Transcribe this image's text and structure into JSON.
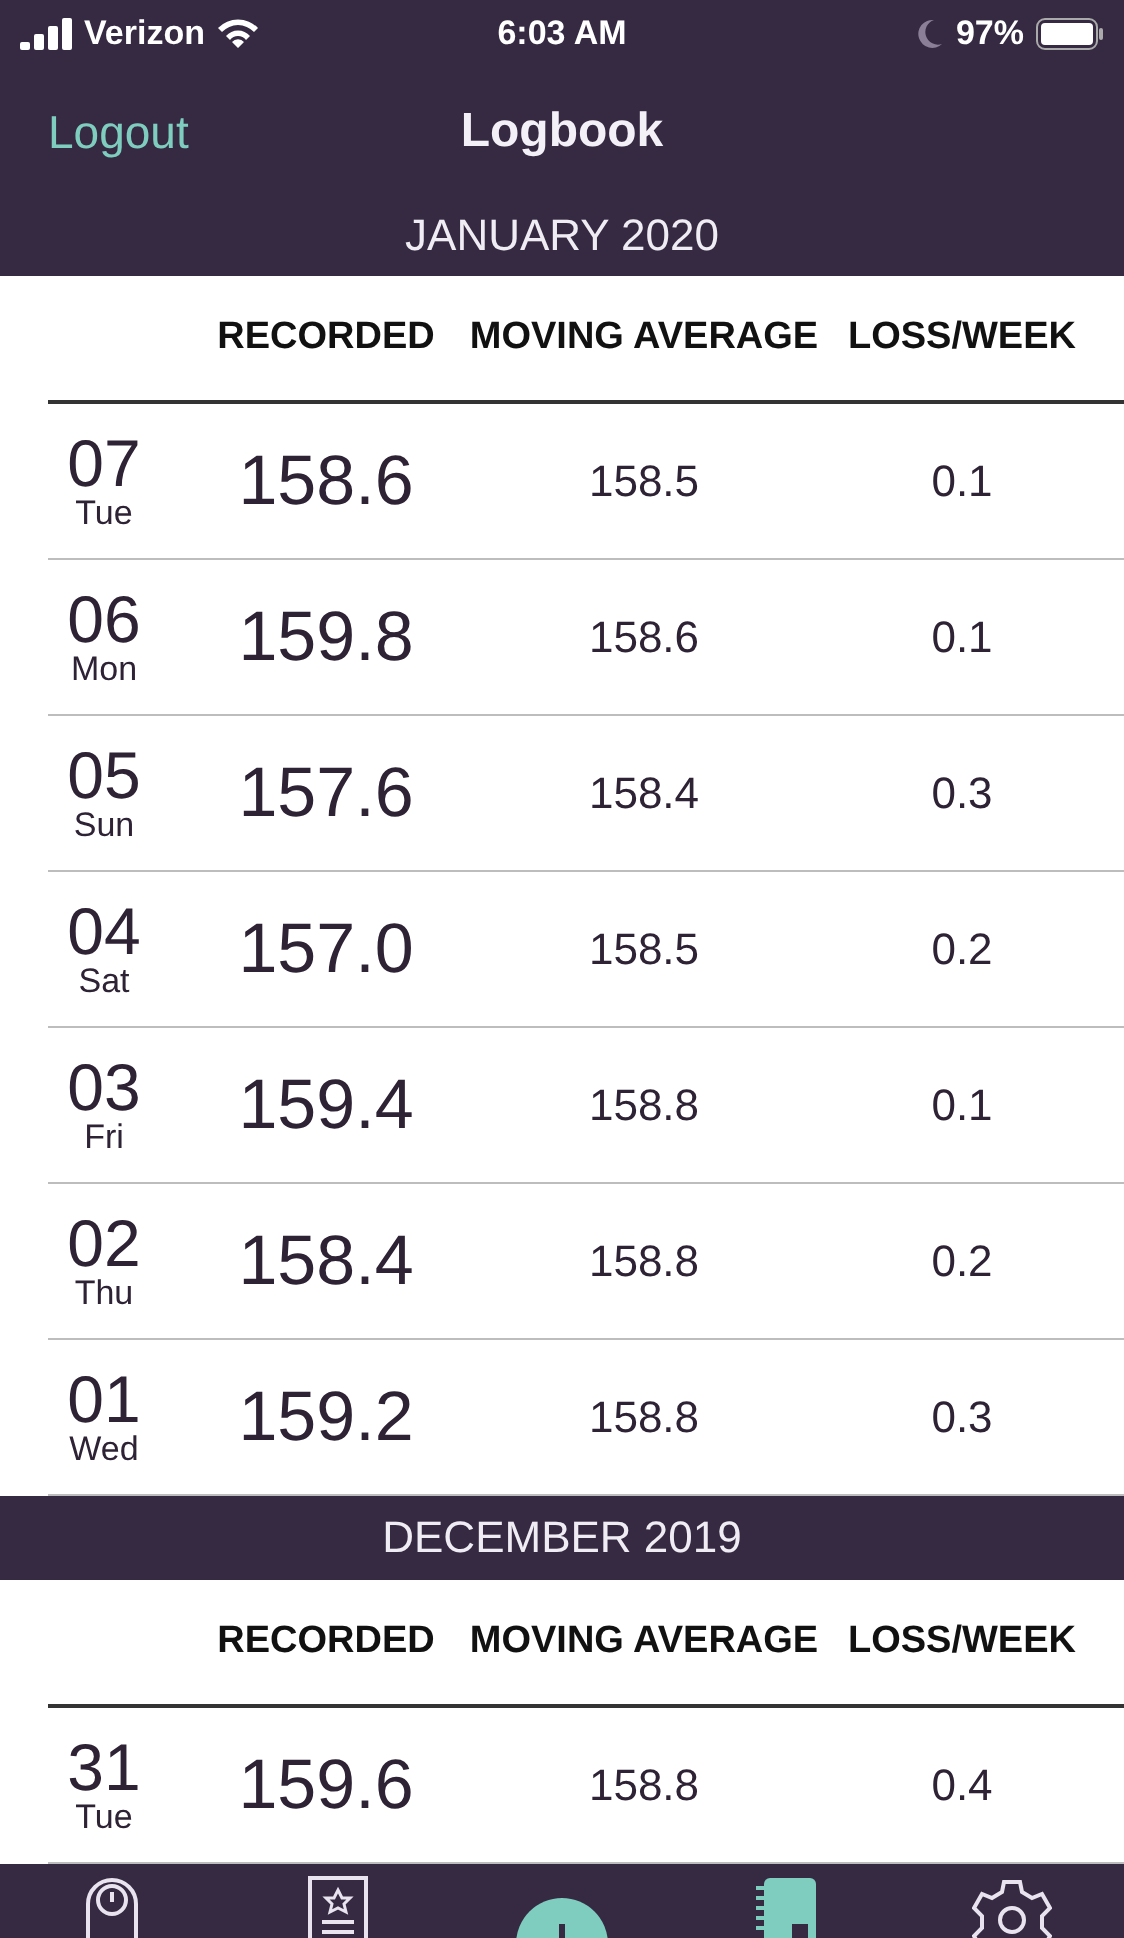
{
  "status_bar": {
    "carrier": "Verizon",
    "time": "6:03 AM",
    "battery": "97%"
  },
  "nav": {
    "left_button": "Logout",
    "title": "Logbook"
  },
  "months": [
    {
      "title": "JANUARY 2020",
      "columns": [
        "RECORDED",
        "MOVING AVERAGE",
        "LOSS/WEEK"
      ],
      "rows": [
        {
          "day": "07",
          "weekday": "Tue",
          "recorded": "158.6",
          "moving_average": "158.5",
          "loss_week": "0.1"
        },
        {
          "day": "06",
          "weekday": "Mon",
          "recorded": "159.8",
          "moving_average": "158.6",
          "loss_week": "0.1"
        },
        {
          "day": "05",
          "weekday": "Sun",
          "recorded": "157.6",
          "moving_average": "158.4",
          "loss_week": "0.3"
        },
        {
          "day": "04",
          "weekday": "Sat",
          "recorded": "157.0",
          "moving_average": "158.5",
          "loss_week": "0.2"
        },
        {
          "day": "03",
          "weekday": "Fri",
          "recorded": "159.4",
          "moving_average": "158.8",
          "loss_week": "0.1"
        },
        {
          "day": "02",
          "weekday": "Thu",
          "recorded": "158.4",
          "moving_average": "158.8",
          "loss_week": "0.2"
        },
        {
          "day": "01",
          "weekday": "Wed",
          "recorded": "159.2",
          "moving_average": "158.8",
          "loss_week": "0.3"
        }
      ]
    },
    {
      "title": "DECEMBER 2019",
      "columns": [
        "RECORDED",
        "MOVING AVERAGE",
        "LOSS/WEEK"
      ],
      "rows": [
        {
          "day": "31",
          "weekday": "Tue",
          "recorded": "159.6",
          "moving_average": "158.8",
          "loss_week": "0.4"
        }
      ]
    }
  ],
  "tab_bar": [
    {
      "kind": "scale",
      "selected": false
    },
    {
      "kind": "list",
      "selected": false
    },
    {
      "kind": "add",
      "selected": false
    },
    {
      "kind": "logbook",
      "selected": true
    },
    {
      "kind": "settings",
      "selected": false
    }
  ]
}
